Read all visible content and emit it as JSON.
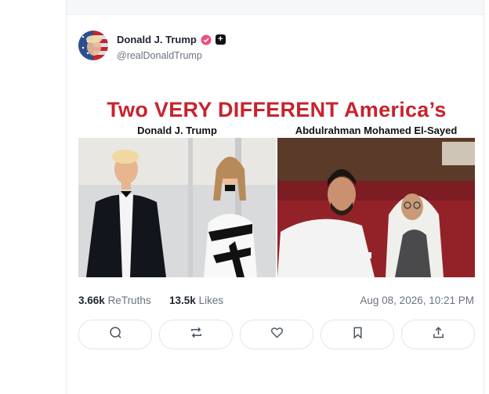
{
  "post": {
    "author": {
      "name": "Donald J. Trump",
      "handle": "@realDonaldTrump",
      "verified": "verified-badge-icon",
      "extra_badge": "plus-badge-icon"
    },
    "image": {
      "title": "Two VERY DIFFERENT America’s",
      "left_caption": "Donald J. Trump",
      "right_caption": "Abdulrahman Mohamed El-Sayed"
    },
    "stats": {
      "retruths_count": "3.66k",
      "retruths_label": "ReTruths",
      "likes_count": "13.5k",
      "likes_label": "Likes",
      "timestamp": "Aug 08, 2026, 10:21 PM"
    },
    "actions": [
      "reply-icon",
      "retruth-icon",
      "like-icon",
      "bookmark-icon",
      "share-icon"
    ]
  },
  "colors": {
    "title_red": "#c8232c",
    "verified_pink": "#ec4f7c",
    "border": "#e3e5e9",
    "muted_text": "#6b7280"
  }
}
